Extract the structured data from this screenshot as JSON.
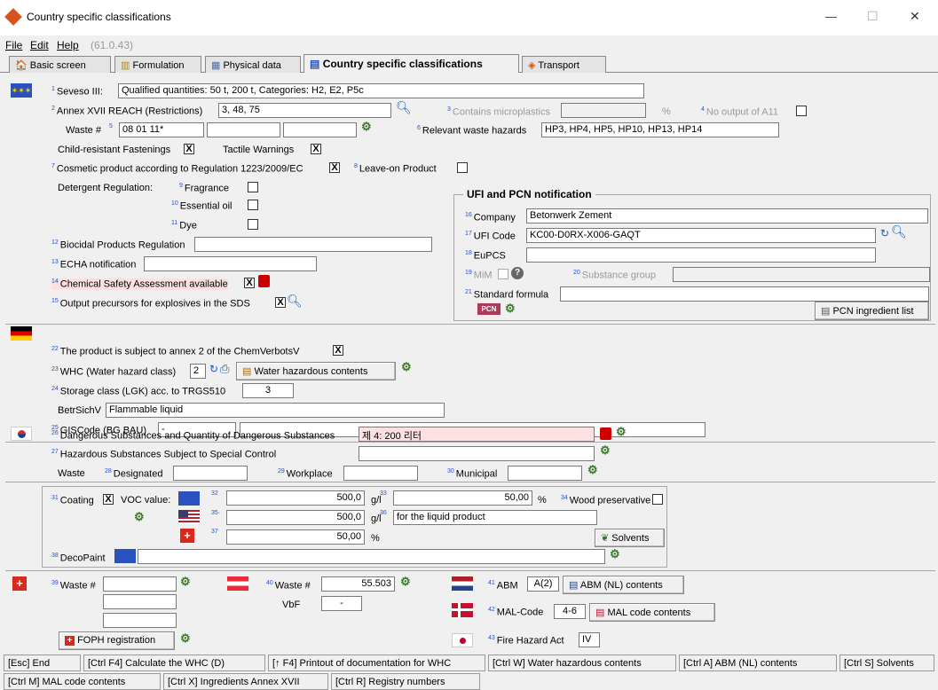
{
  "window": {
    "title": "Country specific classifications",
    "minimize": "—",
    "maximize": "☐",
    "close": "✕"
  },
  "menu": {
    "file": "File",
    "edit": "Edit",
    "help": "Help",
    "version": "(61.0.43)"
  },
  "tabs": [
    "Basic screen",
    "Formulation",
    "Physical data",
    "Country specific classifications",
    "Transport"
  ],
  "eu": {
    "seveso_label": "Seveso III:",
    "seveso_value": "Qualified quantities: 50 t, 200 t, Categories: H2, E2, P5c",
    "annex17_label": "Annex XVII REACH (Restrictions)",
    "annex17_value": "3, 48, 75",
    "microplastics_label": "Contains microplastics",
    "microplastics_unit": "%",
    "no_output_label": "No output of A11",
    "waste_label": "Waste #",
    "waste_value": "08 01 11*",
    "waste_hazards_label": "Relevant waste hazards",
    "waste_hazards_value": "HP3, HP4, HP5, HP10, HP13, HP14",
    "child_resistant_label": "Child-resistant Fastenings",
    "child_resistant_checked": "X",
    "tactile_label": "Tactile Warnings",
    "tactile_checked": "X",
    "cosmetic_label": "Cosmetic product according to Regulation 1223/2009/EC",
    "cosmetic_checked": "X",
    "leave_on_label": "Leave-on Product",
    "detergent_label": "Detergent Regulation:",
    "fragrance_label": "Fragrance",
    "essential_oil_label": "Essential oil",
    "dye_label": "Dye",
    "biocidal_label": "Biocidal Products Regulation",
    "echa_label": "ECHA notification",
    "csa_label": "Chemical Safety Assessment available",
    "csa_checked": "X",
    "explosives_label": "Output precursors for explosives in the SDS",
    "explosives_checked": "X"
  },
  "ufi": {
    "title": "UFI and PCN notification",
    "company_label": "Company",
    "company_value": "Betonwerk Zement",
    "ufi_label": "UFI Code",
    "ufi_value": "KC00-D0RX-X006-GAQT",
    "eupcs_label": "EuPCS",
    "mim_label": "MiM",
    "substance_group_label": "Substance group",
    "standard_formula_label": "Standard formula",
    "pcn_button": "PCN ingredient list"
  },
  "de": {
    "annex2_label": "The product is subject to annex 2 of the ChemVerbotsV",
    "annex2_checked": "X",
    "whc_label": "WHC (Water hazard class)",
    "whc_value": "2",
    "whc_button": "Water hazardous contents",
    "lgk_label": "Storage class (LGK) acc. to TRGS510",
    "lgk_value": "3",
    "betrsichv_label": "BetrSichV",
    "betrsichv_value": "Flammable liquid",
    "giscode_label": "GISCode (BG BAU)",
    "giscode_value": "-"
  },
  "kr": {
    "dangerous_label": "Dangerous Substances and Quantity of Dangerous Substances",
    "dangerous_value": "제 4: 200 리터",
    "hazardous_label": "Hazardous Substances Subject to Special Control",
    "waste_label": "Waste",
    "designated_label": "Designated",
    "workplace_label": "Workplace",
    "municipal_label": "Municipal"
  },
  "voc": {
    "coating_label": "Coating",
    "coating_checked": "X",
    "voc_label": "VOC value:",
    "eu_value": "500,0",
    "eu_unit": "g/l",
    "eu_pct": "50,00",
    "eu_pct_unit": "%",
    "wood_label": "Wood preservative",
    "us_value": "500,0",
    "us_unit": "g/l",
    "us_note": "for the liquid product",
    "ch_value": "50,00",
    "ch_unit": "%",
    "solvents_button": "Solvents",
    "decopaint_label": "DecoPaint"
  },
  "bottom": {
    "ch_waste_label": "Waste #",
    "foph_button": "FOPH registration",
    "at_waste_label": "Waste #",
    "at_waste_value": "55.503",
    "vbf_label": "VbF",
    "vbf_value": "-",
    "abm_label": "ABM",
    "abm_value": "A(2)",
    "abm_button": "ABM (NL) contents",
    "mal_label": "MAL-Code",
    "mal_value": "4-6",
    "mal_button": "MAL code contents",
    "fire_label": "Fire Hazard Act",
    "fire_value": "IV"
  },
  "fkeys": [
    "[Esc] End",
    "[Ctrl F4] Calculate the WHC (D)",
    "[↑ F4] Printout of documentation for WHC",
    "[Ctrl W] Water hazardous contents",
    "[Ctrl A] ABM (NL) contents",
    "[Ctrl S] Solvents",
    "[Ctrl M] MAL code contents",
    "[Ctrl X] Ingredients Annex XVII",
    "[Ctrl R] Registry numbers"
  ],
  "sups": [
    "1",
    "2",
    "3",
    "4",
    "5",
    "6",
    "7",
    "8",
    "9",
    "10",
    "11",
    "12",
    "13",
    "14",
    "15",
    "16",
    "17",
    "18",
    "19",
    "20",
    "21",
    "22",
    "23",
    "24",
    "25",
    "26",
    "27",
    "28",
    "29",
    "30",
    "31",
    "32",
    "33",
    "34",
    "35",
    "36",
    "37",
    "38",
    "39",
    "40",
    "41",
    "42",
    "43"
  ]
}
